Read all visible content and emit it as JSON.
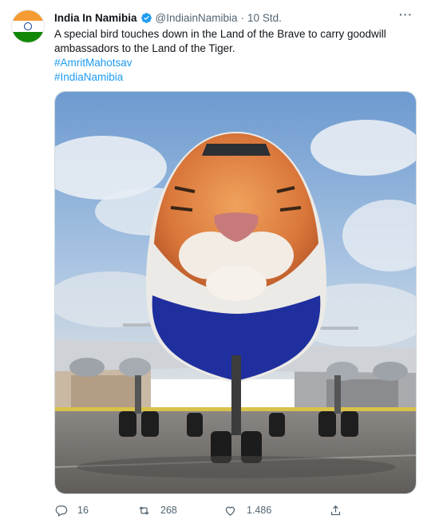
{
  "author": {
    "display_name": "India In Namibia",
    "handle": "@IndiainNamibia",
    "separator": "·",
    "time": "10 Std.",
    "verified": true,
    "avatar": "india-flag-avatar"
  },
  "tweet": {
    "text": "A special bird touches down in the Land of the Brave to carry goodwill ambassadors to the Land of the Tiger.",
    "hashtags": [
      "#AmritMahotsav",
      "#IndiaNamibia"
    ]
  },
  "media": {
    "description_icon": "airplane-photo",
    "colors": {
      "sky": "#7aa6d6",
      "tiger": "#e07a3c",
      "fuselage_blue": "#1f2f9e",
      "tarmac": "#6e6b68"
    }
  },
  "actions": {
    "replies": "16",
    "retweets": "268",
    "likes": "1.486"
  },
  "colors": {
    "accent": "#1d9bf0",
    "muted": "#536471"
  }
}
